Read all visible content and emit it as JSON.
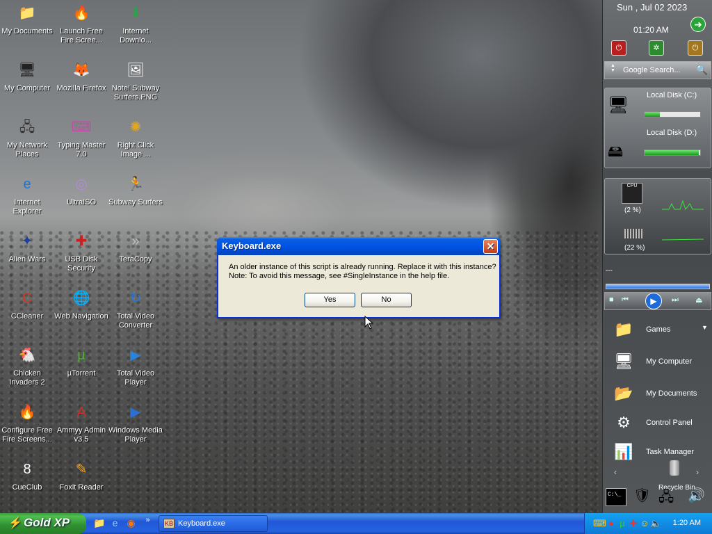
{
  "desktop": {
    "icons": [
      {
        "label": "My Documents",
        "glyph": "📁",
        "color": "#2b4e9a",
        "icon": "my-documents-icon"
      },
      {
        "label": "Launch Free Fire Scree...",
        "glyph": "🔥",
        "color": "#e8641a",
        "icon": "fire-icon"
      },
      {
        "label": "Internet Downlo...",
        "glyph": "⬇",
        "color": "#2aa14a",
        "icon": "download-globe-icon"
      },
      {
        "label": "My Computer",
        "glyph": "🖥",
        "color": "#222222",
        "icon": "monitor-icon"
      },
      {
        "label": "Mozilla Firefox",
        "glyph": "🦊",
        "color": "#e66a1e",
        "icon": "firefox-icon"
      },
      {
        "label": "Note! Subway Surfers.PNG",
        "glyph": "🖼",
        "color": "#ffffff",
        "icon": "image-file-icon"
      },
      {
        "label": "My Network Places",
        "glyph": "🖧",
        "color": "#333333",
        "icon": "network-places-icon"
      },
      {
        "label": "Typing Master 7.0",
        "glyph": "⌨",
        "color": "#c44aa8",
        "icon": "typing-master-icon"
      },
      {
        "label": "Right Click Image ...",
        "glyph": "✺",
        "color": "#e5a81c",
        "icon": "sun-gear-icon"
      },
      {
        "label": "Internet Explorer",
        "glyph": "e",
        "color": "#1b74d8",
        "icon": "internet-explorer-icon"
      },
      {
        "label": "UltraISO",
        "glyph": "◎",
        "color": "#b58bd6",
        "icon": "disc-icon"
      },
      {
        "label": "Subway Surfers",
        "glyph": "🏃",
        "color": "#3e7f33",
        "icon": "subway-surfers-icon"
      },
      {
        "label": "Alien Wars",
        "glyph": "✦",
        "color": "#1c3f9e",
        "icon": "alien-wars-icon"
      },
      {
        "label": "USB Disk Security",
        "glyph": "✚",
        "color": "#cc2020",
        "icon": "shield-icon"
      },
      {
        "label": "TeraCopy",
        "glyph": "»",
        "color": "#bfbfbf",
        "icon": "teracopy-icon"
      },
      {
        "label": "CCleaner",
        "glyph": "C",
        "color": "#d13a22",
        "icon": "ccleaner-icon"
      },
      {
        "label": "Web Navigation",
        "glyph": "🌐",
        "color": "#3a7bd5",
        "icon": "globe-icon"
      },
      {
        "label": "Total Video Converter",
        "glyph": "↻",
        "color": "#2a78d6",
        "icon": "converter-icon"
      },
      {
        "label": "Chicken Invaders 2",
        "glyph": "🐔",
        "color": "#d83a2a",
        "icon": "chicken-icon"
      },
      {
        "label": "µTorrent",
        "glyph": "µ",
        "color": "#4fae2f",
        "icon": "utorrent-icon"
      },
      {
        "label": "Total Video Player",
        "glyph": "▶",
        "color": "#2a83d9",
        "icon": "video-player-icon"
      },
      {
        "label": "Configure Free Fire Screens...",
        "glyph": "🔥",
        "color": "#e8641a",
        "icon": "fire-config-icon"
      },
      {
        "label": "Ammyy Admin v3.5",
        "glyph": "A",
        "color": "#c9302c",
        "icon": "ammyy-admin-icon"
      },
      {
        "label": "Windows Media Player",
        "glyph": "▶",
        "color": "#2b6ed4",
        "icon": "media-player-icon"
      },
      {
        "label": "CueClub",
        "glyph": "8",
        "color": "#ffffff",
        "icon": "cueclub-icon"
      },
      {
        "label": "Foxit Reader",
        "glyph": "✎",
        "color": "#f0a020",
        "icon": "foxit-reader-icon"
      }
    ]
  },
  "dialog": {
    "title": "Keyboard.exe",
    "close_glyph": "✕",
    "line1": "An older instance of this script is already running.  Replace it with this instance?",
    "line2": "Note: To avoid this message, see #SingleInstance in the help file.",
    "yes_label": "Yes",
    "no_label": "No"
  },
  "sidebar": {
    "date": "Sun , Jul 02 2023",
    "time": "01:20 AM",
    "search_placeholder": "Google Search...",
    "disks": [
      {
        "label": "Local Disk (C:)",
        "used_fraction": 0.27
      },
      {
        "label": "Local Disk (D:)",
        "used_fraction": 0.97
      }
    ],
    "cpu_percent": "(2 %)",
    "mem_percent": "(22 %)",
    "cpu_label": "CPU",
    "media_title": "---",
    "items": [
      {
        "label": "Games",
        "glyph": "📁",
        "icon": "games-folder-icon"
      },
      {
        "label": "My Computer",
        "glyph": "🖥",
        "icon": "my-computer-icon"
      },
      {
        "label": "My Documents",
        "glyph": "📂",
        "icon": "my-documents-folder-icon"
      },
      {
        "label": "Control Panel",
        "glyph": "⚙",
        "icon": "control-panel-icon"
      },
      {
        "label": "Task Manager",
        "glyph": "📊",
        "icon": "task-manager-icon"
      }
    ],
    "recycle_label": "Recycle Bin",
    "cmd_label": "C:\\_"
  },
  "taskbar": {
    "start_label": "Gold XP",
    "task_label": "Keyboard.exe",
    "task_icon_text": "KB",
    "clock": "1:20 AM",
    "quicklaunch_more": "»"
  }
}
